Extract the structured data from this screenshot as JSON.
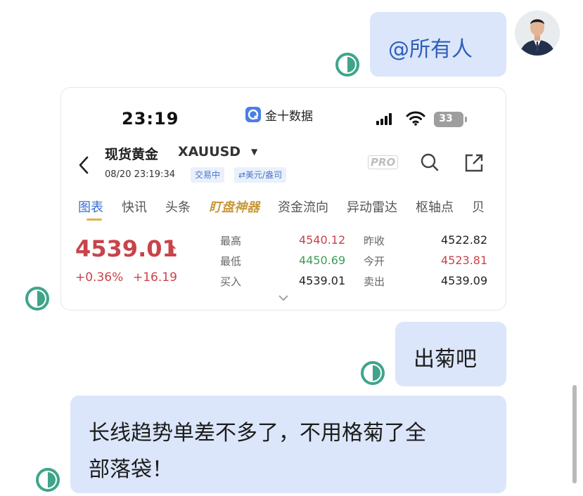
{
  "messages": {
    "at_all": "@所有人",
    "chu_ju": "出菊吧",
    "long_line_1": "长线趋势单差不多了，不用格菊了全",
    "long_line_2": "部落袋！"
  },
  "screenshot": {
    "status_bar": {
      "time": "23:19",
      "app_name": "金十数据",
      "battery": "33"
    },
    "header": {
      "back_icon": "chevron-left-icon",
      "title": "现货黄金",
      "symbol": "XAUUSD",
      "datetime": "08/20 23:19:34",
      "tag_trading": "交易中",
      "tag_currency": "⇄美元/盎司",
      "pro_badge": "PRO",
      "search_icon": "search-icon",
      "share_icon": "share-icon"
    },
    "tabs": [
      {
        "label": "图表"
      },
      {
        "label": "快讯"
      },
      {
        "label": "头条"
      },
      {
        "label": "盯盘神器"
      },
      {
        "label": "资金流向"
      },
      {
        "label": "异动雷达"
      },
      {
        "label": "枢轴点"
      },
      {
        "label": "贝"
      }
    ],
    "quote": {
      "price": "4539.01",
      "arrow": "↑",
      "change_pct": "+0.36%",
      "change_abs": "+16.19",
      "high_label": "最高",
      "high_value": "4540.12",
      "low_label": "最低",
      "low_value": "4450.69",
      "buy_label": "买入",
      "buy_value": "4539.01",
      "prev_close_label": "昨收",
      "prev_close_value": "4522.82",
      "open_label": "今开",
      "open_value": "4523.81",
      "sell_label": "卖出",
      "sell_value": "4539.09"
    }
  },
  "colors": {
    "bubble": "#dbe6fb",
    "read_status": "#3fa58a",
    "up_red": "#c9434a",
    "down_green": "#3f9c57",
    "accent_blue": "#3a6fd1"
  }
}
